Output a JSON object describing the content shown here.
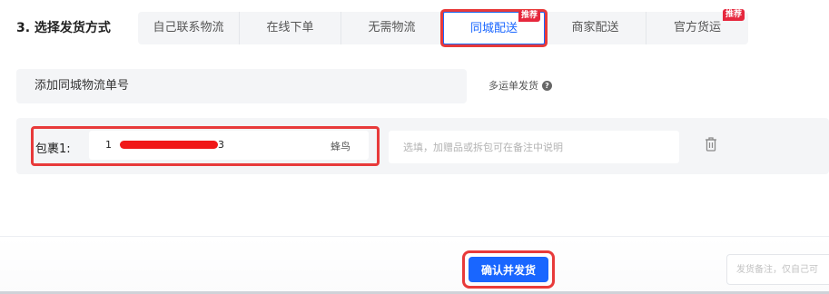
{
  "section": {
    "title": "3. 选择发货方式"
  },
  "tabs": [
    {
      "label": "自己联系物流",
      "active": false,
      "badge": ""
    },
    {
      "label": "在线下单",
      "active": false,
      "badge": ""
    },
    {
      "label": "无需物流",
      "active": false,
      "badge": ""
    },
    {
      "label": "同城配送",
      "active": true,
      "badge": "推荐"
    },
    {
      "label": "商家配送",
      "active": false,
      "badge": ""
    },
    {
      "label": "官方货运",
      "active": false,
      "badge": "推荐"
    }
  ],
  "add_tracking": {
    "label": "添加同城物流单号"
  },
  "multi_ship": {
    "label": "多运单发货",
    "icon": "help-circle-icon"
  },
  "package": {
    "label": "包裹1:",
    "tracking_prefix": "1",
    "tracking_suffix": "3",
    "carrier": "蜂鸟",
    "remark_placeholder": "选填，加赠品或拆包可在备注中说明",
    "delete_icon": "trash-icon"
  },
  "footer": {
    "confirm_label": "确认并发货",
    "remark_placeholder": "发货备注，仅自己可"
  },
  "colors": {
    "accent": "#1966ff",
    "badge": "#e6273d",
    "highlight_outline": "#e83a3a"
  }
}
